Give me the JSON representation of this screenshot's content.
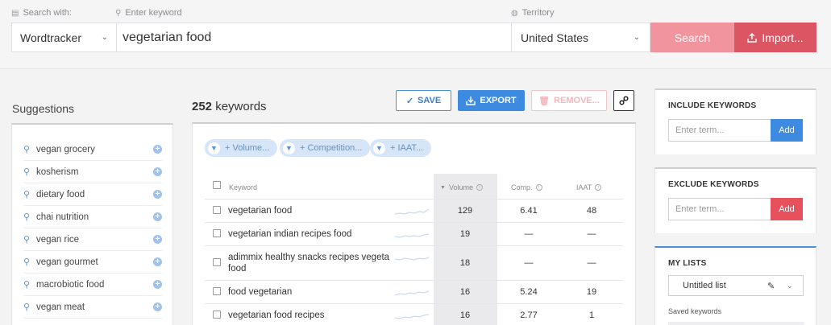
{
  "search": {
    "search_with_label": "Search with:",
    "keyword_label": "Enter keyword",
    "territory_label": "Territory",
    "source": "Wordtracker",
    "keyword_value": "vegetarian food",
    "territory": "United States",
    "search_button": "Search",
    "import_button": "Import..."
  },
  "suggestions": {
    "title": "Suggestions",
    "items": [
      "vegan grocery",
      "kosherism",
      "dietary food",
      "chai nutrition",
      "vegan rice",
      "vegan gourmet",
      "macrobiotic food",
      "vegan meat"
    ]
  },
  "results": {
    "count": "252",
    "count_suffix": "keywords",
    "save_button": "SAVE",
    "export_button": "EXPORT",
    "remove_button": "REMOVE...",
    "filters": [
      "+ Volume...",
      "+ Competition...",
      "+ IAAT..."
    ],
    "columns": {
      "keyword": "Keyword",
      "volume": "Volume",
      "comp": "Comp.",
      "iaat": "IAAT"
    },
    "rows": [
      {
        "keyword": "vegetarian food",
        "volume": "129",
        "comp": "6.41",
        "iaat": "48"
      },
      {
        "keyword": "vegetarian indian recipes food",
        "volume": "19",
        "comp": "—",
        "iaat": "—"
      },
      {
        "keyword": "adimmix healthy snacks recipes vegeta food",
        "volume": "18",
        "comp": "—",
        "iaat": "—"
      },
      {
        "keyword": "food vegetarian",
        "volume": "16",
        "comp": "5.24",
        "iaat": "19"
      },
      {
        "keyword": "vegetarian food recipes",
        "volume": "16",
        "comp": "2.77",
        "iaat": "1"
      }
    ]
  },
  "include": {
    "title": "INCLUDE KEYWORDS",
    "placeholder": "Enter term...",
    "add": "Add",
    "color": "#3d8be0"
  },
  "exclude": {
    "title": "EXCLUDE KEYWORDS",
    "placeholder": "Enter term...",
    "add": "Add",
    "color": "#e8505e"
  },
  "lists": {
    "title": "MY LISTS",
    "selected": "Untitled list",
    "saved_label": "Saved keywords"
  }
}
